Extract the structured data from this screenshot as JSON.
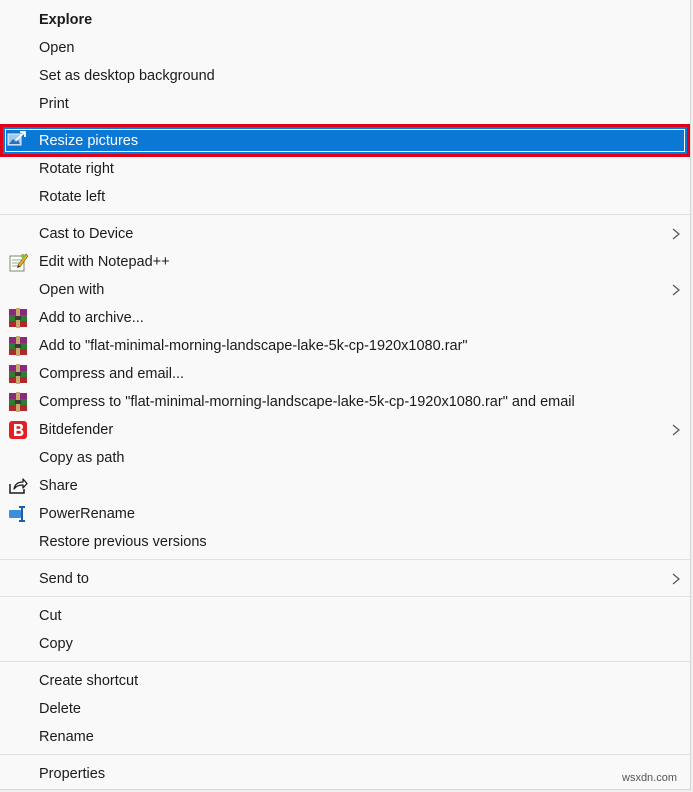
{
  "menu": {
    "explore": "Explore",
    "open": "Open",
    "set_desktop": "Set as desktop background",
    "print": "Print",
    "resize": "Resize pictures",
    "rotate_right": "Rotate right",
    "rotate_left": "Rotate left",
    "cast": "Cast to Device",
    "edit_notepad": "Edit with Notepad++",
    "open_with": "Open with",
    "add_archive": "Add to archive...",
    "add_to_rar": "Add to \"flat-minimal-morning-landscape-lake-5k-cp-1920x1080.rar\"",
    "compress_email": "Compress and email...",
    "compress_to_rar_email": "Compress to \"flat-minimal-morning-landscape-lake-5k-cp-1920x1080.rar\" and email",
    "bitdefender": "Bitdefender",
    "copy_path": "Copy as path",
    "share": "Share",
    "powerrename": "PowerRename",
    "restore": "Restore previous versions",
    "send_to": "Send to",
    "cut": "Cut",
    "copy": "Copy",
    "create_shortcut": "Create shortcut",
    "delete": "Delete",
    "rename": "Rename",
    "properties": "Properties"
  },
  "icons": {
    "resize": "resize-pictures-icon",
    "notepad": "notepad-plus-plus-icon",
    "winrar": "winrar-icon",
    "bitdefender": "bitdefender-icon",
    "share": "share-icon",
    "powerrename": "powerrename-icon",
    "submenu": "chevron-right-icon"
  },
  "colors": {
    "highlight": "#0a78d4",
    "highlight_border": "#e00019"
  },
  "watermark": "wsxdn.com"
}
